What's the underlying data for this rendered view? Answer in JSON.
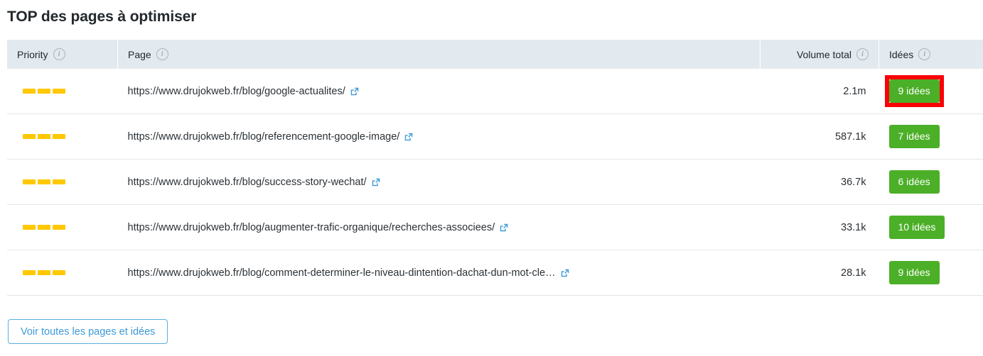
{
  "page_title": "TOP des pages à optimiser",
  "table": {
    "columns": [
      {
        "key": "priority",
        "label": "Priority",
        "info_icon": "info-icon"
      },
      {
        "key": "page",
        "label": "Page",
        "info_icon": "info-icon"
      },
      {
        "key": "volume",
        "label": "Volume total",
        "info_icon": "info-icon"
      },
      {
        "key": "idees",
        "label": "Idées",
        "info_icon": "info-icon"
      }
    ],
    "rows": [
      {
        "priority_segments": 3,
        "url": "https://www.drujokweb.fr/blog/google-actualites/",
        "link_icon": "external-link-icon",
        "volume": "2.1m",
        "idees": "9 idées",
        "highlighted": true
      },
      {
        "priority_segments": 3,
        "url": "https://www.drujokweb.fr/blog/referencement-google-image/",
        "link_icon": "external-link-icon",
        "volume": "587.1k",
        "idees": "7 idées",
        "highlighted": false
      },
      {
        "priority_segments": 3,
        "url": "https://www.drujokweb.fr/blog/success-story-wechat/",
        "link_icon": "external-link-icon",
        "volume": "36.7k",
        "idees": "6 idées",
        "highlighted": false
      },
      {
        "priority_segments": 3,
        "url": "https://www.drujokweb.fr/blog/augmenter-trafic-organique/recherches-associees/",
        "link_icon": "external-link-icon",
        "volume": "33.1k",
        "idees": "10 idées",
        "highlighted": false
      },
      {
        "priority_segments": 3,
        "url": "https://www.drujokweb.fr/blog/comment-determiner-le-niveau-dintention-dachat-dun-mot-cle…",
        "link_icon": "external-link-icon",
        "volume": "28.1k",
        "idees": "9 idées",
        "highlighted": false
      }
    ]
  },
  "footer": {
    "button_label": "Voir toutes les pages et idées"
  },
  "colors": {
    "priority_bar": "#ffc800",
    "badge_green": "#4caf28",
    "highlight_red": "#fb0007",
    "link_blue": "#3d9ad8",
    "header_bg": "#e3eaef"
  }
}
